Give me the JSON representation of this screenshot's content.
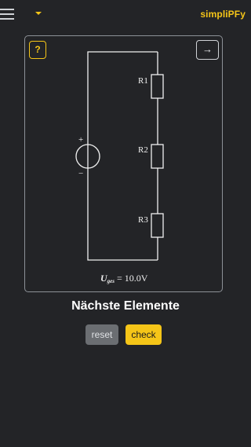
{
  "header": {
    "brand": "simpliPFy",
    "menu_icon": "hamburger-icon",
    "dropdown_icon": "caret-down-icon"
  },
  "card": {
    "help_label": "?",
    "next_label": "→",
    "circuit": {
      "resistors": [
        "R1",
        "R2",
        "R3"
      ],
      "source_plus": "+",
      "source_minus": "−",
      "voltage_symbol": "U",
      "voltage_subscript": "ges",
      "voltage_value": "= 10.0V"
    }
  },
  "main": {
    "title": "Nächste Elemente",
    "reset_label": "reset",
    "check_label": "check"
  },
  "colors": {
    "background": "#232427",
    "accent": "#f5c518",
    "wire": "#f0f0f0"
  }
}
